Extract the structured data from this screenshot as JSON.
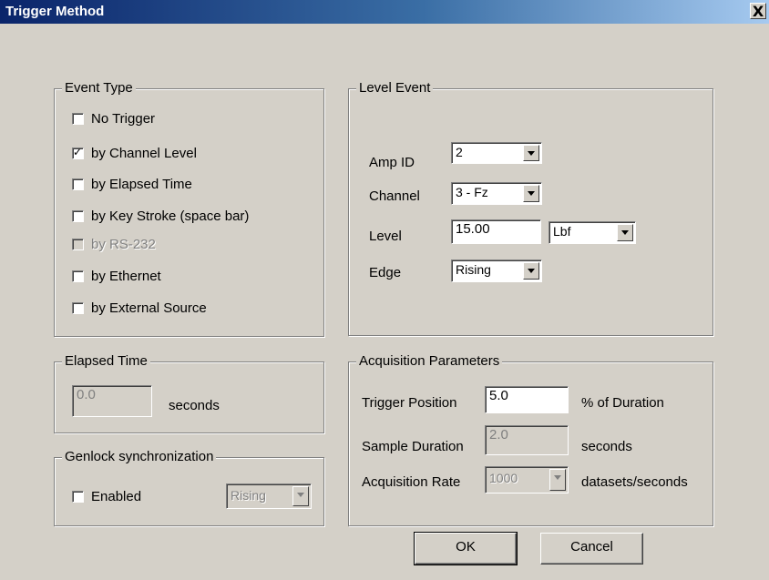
{
  "window": {
    "title": "Trigger Method",
    "close_glyph": "X"
  },
  "event_type": {
    "title": "Event Type",
    "options": [
      {
        "label": "No Trigger",
        "checked": false,
        "enabled": true
      },
      {
        "label": "by Channel Level",
        "checked": true,
        "enabled": true
      },
      {
        "label": "by Elapsed Time",
        "checked": false,
        "enabled": true
      },
      {
        "label": "by Key Stroke (space bar)",
        "checked": false,
        "enabled": true
      },
      {
        "label": "by RS-232",
        "checked": false,
        "enabled": false
      },
      {
        "label": "by Ethernet",
        "checked": false,
        "enabled": true
      },
      {
        "label": "by External Source",
        "checked": false,
        "enabled": true
      }
    ]
  },
  "level_event": {
    "title": "Level Event",
    "amp_id": {
      "label": "Amp ID",
      "value": "2"
    },
    "channel": {
      "label": "Channel",
      "value": "3 - Fz"
    },
    "level": {
      "label": "Level",
      "value": "15.00",
      "unit": "Lbf"
    },
    "edge": {
      "label": "Edge",
      "value": "Rising"
    }
  },
  "elapsed_time": {
    "title": "Elapsed Time",
    "value": "0.0",
    "unit": "seconds"
  },
  "genlock": {
    "title": "Genlock synchronization",
    "enabled_label": "Enabled",
    "enabled_checked": false,
    "edge_value": "Rising"
  },
  "acquisition": {
    "title": "Acquisition Parameters",
    "trigger_position": {
      "label": "Trigger Position",
      "value": "5.0",
      "unit": "% of Duration"
    },
    "sample_duration": {
      "label": "Sample Duration",
      "value": "2.0",
      "unit": "seconds"
    },
    "acquisition_rate": {
      "label": "Acquisition Rate",
      "value": "1000",
      "unit": "datasets/seconds"
    }
  },
  "buttons": {
    "ok": "OK",
    "cancel": "Cancel"
  },
  "colors": {
    "title_gradient_start": "#0a246a",
    "title_gradient_end": "#a6caf0",
    "dialog_bg": "#d4d0c8"
  }
}
